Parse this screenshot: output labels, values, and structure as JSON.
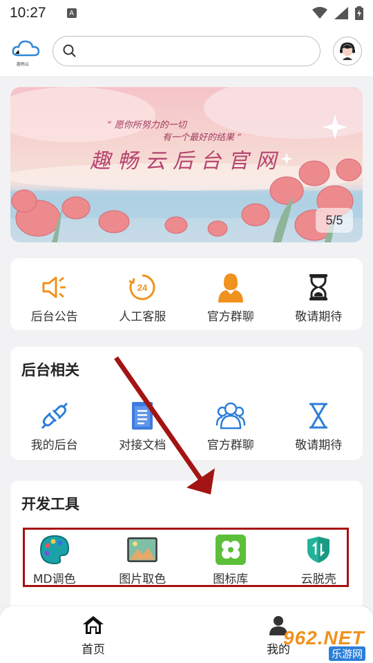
{
  "status_bar": {
    "time": "10:27",
    "notif_letter": "A"
  },
  "header": {
    "logo_caption": "趣畅云",
    "search_placeholder": ""
  },
  "banner": {
    "title": "趣畅云后台官网",
    "quote_line1": "“ 愿你所努力的一切",
    "quote_line2": "有一个最好的结果 ”",
    "counter": "5/5"
  },
  "quick_actions": [
    {
      "label": "后台公告",
      "icon": "speaker-icon"
    },
    {
      "label": "人工客服",
      "icon": "24h-clock-icon"
    },
    {
      "label": "官方群聊",
      "icon": "person-icon"
    },
    {
      "label": "敬请期待",
      "icon": "hourglass-icon"
    }
  ],
  "backend_section": {
    "title": "后台相关",
    "items": [
      {
        "label": "我的后台",
        "icon": "plug-icon"
      },
      {
        "label": "对接文档",
        "icon": "document-icon"
      },
      {
        "label": "官方群聊",
        "icon": "group-icon"
      },
      {
        "label": "敬请期待",
        "icon": "hourglass-outline-icon"
      }
    ]
  },
  "dev_tools_section": {
    "title": "开发工具",
    "items": [
      {
        "label": "MD调色",
        "icon": "palette-icon"
      },
      {
        "label": "图片取色",
        "icon": "image-icon"
      },
      {
        "label": "图标库",
        "icon": "clover-icon"
      },
      {
        "label": "云脱壳",
        "icon": "shield-icon"
      }
    ]
  },
  "bottom_nav": {
    "home": "首页",
    "me": "我的"
  },
  "watermark": {
    "text": "962.NET",
    "sub": "乐游网"
  },
  "colors": {
    "accent_orange": "#f0921e",
    "accent_blue": "#2b7ed8",
    "highlight_red": "#a80f0f"
  }
}
